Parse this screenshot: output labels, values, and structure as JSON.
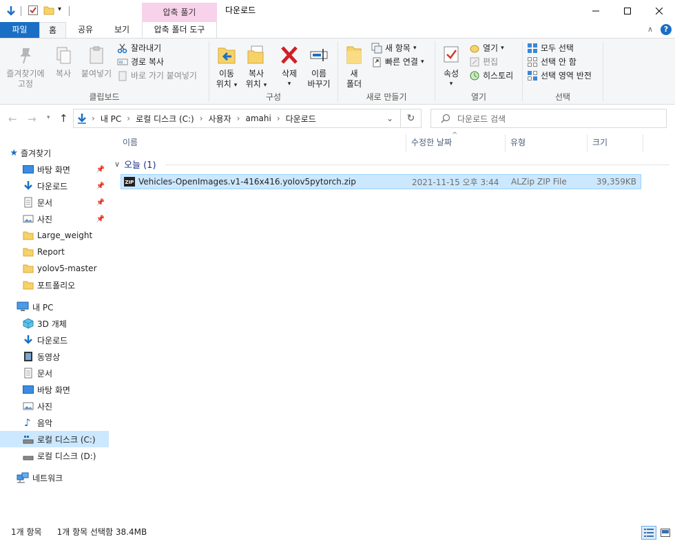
{
  "titlebar": {
    "context_tab": "압축 풀기",
    "window_title": "다운로드",
    "minimize": "—",
    "maximize": "☐",
    "close": "✕"
  },
  "tabs": {
    "file": "파일",
    "home": "홈",
    "share": "공유",
    "view": "보기",
    "compressed_tools": "압축 폴더 도구"
  },
  "ribbon": {
    "clipboard": {
      "label": "클립보드",
      "pin_line1": "즐겨찾기에",
      "pin_line2": "고정",
      "copy": "복사",
      "paste": "붙여넣기",
      "cut": "잘라내기",
      "copy_path": "경로 복사",
      "paste_shortcut": "바로 가기 붙여넣기"
    },
    "organize": {
      "label": "구성",
      "move_line1": "이동",
      "move_line2": "위치",
      "copyto_line1": "복사",
      "copyto_line2": "위치",
      "delete": "삭제",
      "rename_line1": "이름",
      "rename_line2": "바꾸기"
    },
    "new": {
      "label": "새로 만들기",
      "folder_line1": "새",
      "folder_line2": "폴더",
      "new_item": "새 항목",
      "easy_access": "빠른 연결"
    },
    "open": {
      "label": "열기",
      "properties": "속성",
      "open": "열기",
      "edit": "편집",
      "history": "히스토리"
    },
    "select": {
      "label": "선택",
      "select_all": "모두 선택",
      "select_none": "선택 안 함",
      "invert": "선택 영역 반전"
    }
  },
  "address": {
    "segments": [
      "내 PC",
      "로컬 디스크 (C:)",
      "사용자",
      "amahi",
      "다운로드"
    ],
    "separator": "›",
    "search_placeholder": "다운로드 검색"
  },
  "nav": {
    "quick_access": "즐겨찾기",
    "qa_items": [
      "바탕 화면",
      "다운로드",
      "문서",
      "사진",
      "Large_weight",
      "Report",
      "yolov5-master",
      "포트폴리오"
    ],
    "this_pc": "내 PC",
    "pc_items": [
      "3D 개체",
      "다운로드",
      "동영상",
      "문서",
      "바탕 화면",
      "사진",
      "음악",
      "로컬 디스크 (C:)",
      "로컬 디스크 (D:)"
    ],
    "network": "네트워크"
  },
  "columns": {
    "name": "이름",
    "modified": "수정한 날짜",
    "type": "유형",
    "size": "크기"
  },
  "group": {
    "label": "오늘 (1)"
  },
  "files": [
    {
      "name": "Vehicles-OpenImages.v1-416x416.yolov5pytorch.zip",
      "modified": "2021-11-15 오후 3:44",
      "type": "ALZip ZIP File",
      "size": "39,359KB",
      "selected": true
    }
  ],
  "status": {
    "item_count": "1개 항목",
    "selection": "1개 항목 선택함 38.4MB"
  },
  "colors": {
    "file_tab": "#1a6fc4",
    "context_tab": "#f8d1ea",
    "selection": "#cce8ff",
    "group_header": "#1e3287"
  }
}
